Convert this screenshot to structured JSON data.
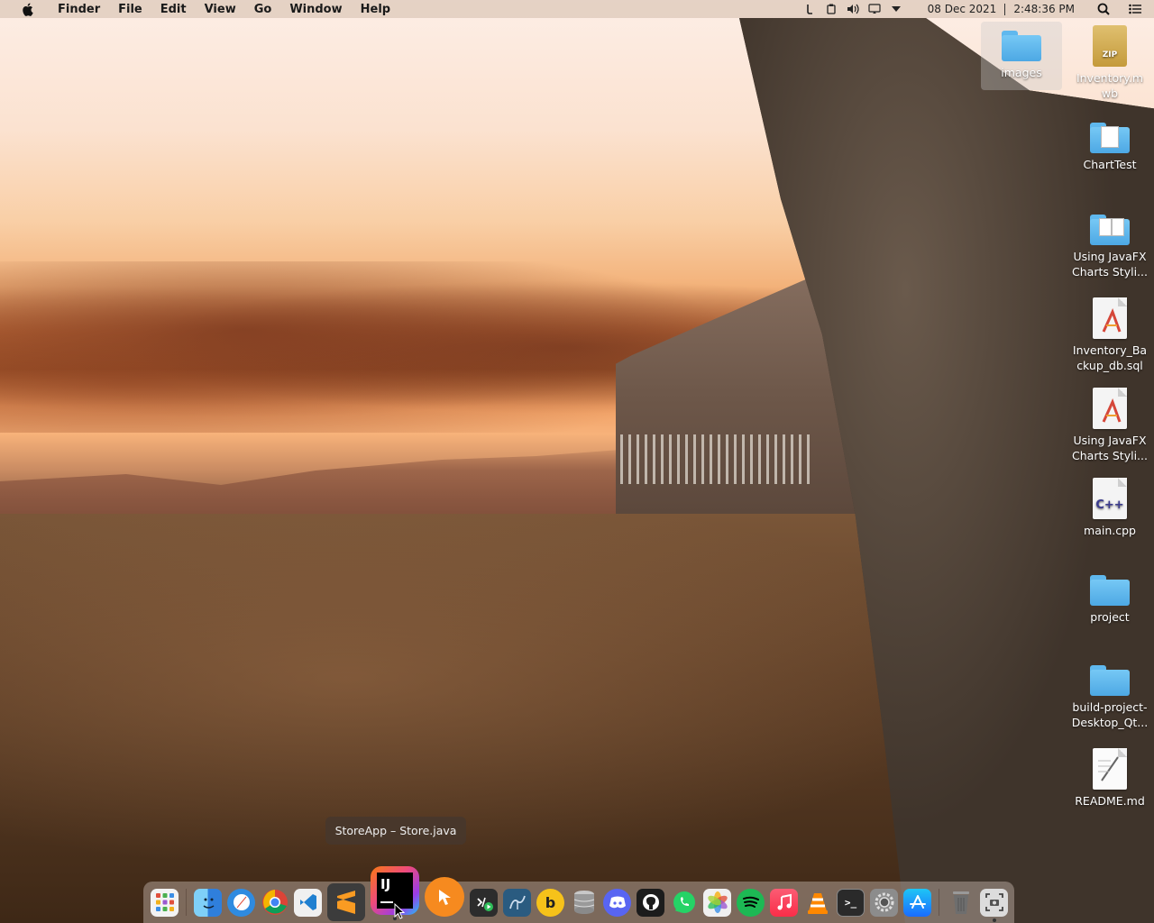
{
  "menubar": {
    "app_name": "Finder",
    "menus": [
      "File",
      "Edit",
      "View",
      "Go",
      "Window",
      "Help"
    ],
    "date": "08 Dec 2021",
    "time": "2:48:36 PM",
    "status_icons": [
      "script-icon",
      "clipboard-icon",
      "volume-icon",
      "airplay-display-icon",
      "wifi-dropdown-icon"
    ]
  },
  "desktop_icons": [
    {
      "label": "images",
      "type": "folder"
    },
    {
      "label": "Inventory.mwb",
      "type": "zip"
    },
    {
      "label": "ChartTest",
      "type": "folder-doc"
    },
    {
      "label": "Using JavaFX Charts Styli...",
      "type": "folder-doc"
    },
    {
      "label": "Inventory_Backup_db.sql",
      "type": "sql"
    },
    {
      "label": "Using JavaFX Charts Styli...",
      "type": "sql"
    },
    {
      "label": "main.cpp",
      "type": "cpp"
    },
    {
      "label": "project",
      "type": "folder"
    },
    {
      "label": "build-project-Desktop_Qt...",
      "type": "folder"
    },
    {
      "label": "README.md",
      "type": "md"
    }
  ],
  "tooltip": "StoreApp – Store.java",
  "dock": {
    "items": [
      {
        "name": "launchpad",
        "color": "#f3f3f3"
      },
      {
        "name": "finder",
        "color": "#3a8ee6"
      },
      {
        "name": "safari",
        "color": "#2f8be0"
      },
      {
        "name": "chrome",
        "color": "#e8e8e8"
      },
      {
        "name": "vscode",
        "color": "#1f7fd0"
      },
      {
        "name": "sublime-text",
        "color": "#3c3c3c"
      },
      {
        "name": "intellij-idea",
        "color": "#ef4b7a"
      },
      {
        "name": "postman-pointer",
        "color": "#f68a1f"
      },
      {
        "name": "devtool",
        "color": "#2c2c2c"
      },
      {
        "name": "mysql-workbench",
        "color": "#2a5b80"
      },
      {
        "name": "bbedit",
        "color": "#f6c21a"
      },
      {
        "name": "database",
        "color": "#9a9a9a"
      },
      {
        "name": "discord",
        "color": "#5865f2"
      },
      {
        "name": "github",
        "color": "#1c1c1c"
      },
      {
        "name": "whatsapp",
        "color": "#25d366"
      },
      {
        "name": "photos",
        "color": "#f0f0f0"
      },
      {
        "name": "spotify",
        "color": "#1db954"
      },
      {
        "name": "music",
        "color": "#fa2d48"
      },
      {
        "name": "vlc",
        "color": "#ff8800"
      },
      {
        "name": "terminal",
        "color": "#2a2a2a"
      },
      {
        "name": "system-preferences",
        "color": "#8c8c8c"
      },
      {
        "name": "app-store",
        "color": "#1a8cff"
      },
      {
        "name": "trash",
        "color": "#7a7a7a"
      },
      {
        "name": "screenshot",
        "color": "#dcdcdc"
      }
    ]
  }
}
